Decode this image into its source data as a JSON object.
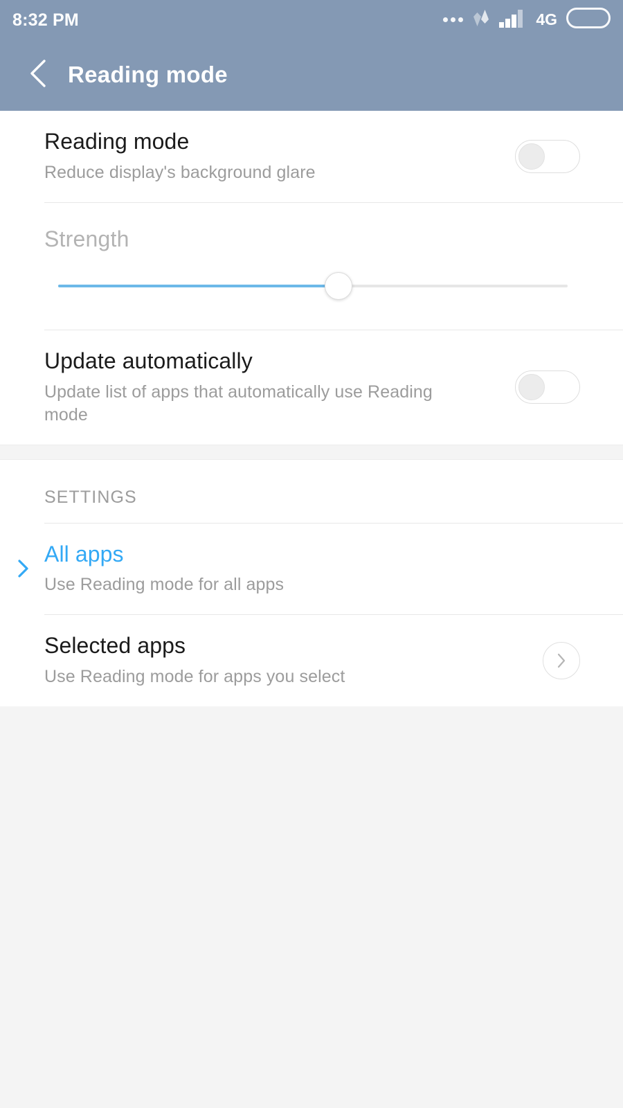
{
  "status_bar": {
    "time": "8:32 PM",
    "network_label": "4G",
    "icons": [
      "more-dots-icon",
      "data-transfer-icon",
      "signal-bars-icon",
      "battery-icon"
    ]
  },
  "app_bar": {
    "back_icon": "chevron-left-icon",
    "title": "Reading mode"
  },
  "colors": {
    "header_bg": "#8499b4",
    "accent_blue": "#33a9f5",
    "slider_fill": "#6cb8e8",
    "card_bg": "#ffffff",
    "page_bg": "#f4f4f4",
    "title_text": "#1b1b1b",
    "subtitle_text": "#9c9c9c",
    "divider": "#e8e8e8"
  },
  "settings": {
    "reading_mode": {
      "title": "Reading mode",
      "subtitle": "Reduce display's background glare",
      "toggle_state": "off"
    },
    "strength": {
      "label": "Strength",
      "value_percent": 55,
      "min": 0,
      "max": 100,
      "enabled": false
    },
    "update_automatically": {
      "title": "Update automatically",
      "subtitle": "Update list of apps that automatically use Reading mode",
      "toggle_state": "off"
    }
  },
  "section": {
    "header": "SETTINGS",
    "items": [
      {
        "title": "All apps",
        "subtitle": "Use Reading mode for all apps",
        "selected": true,
        "marker_icon": "chevron-right-icon"
      },
      {
        "title": "Selected apps",
        "subtitle": "Use Reading mode for apps you select",
        "selected": false,
        "marker_icon": "chevron-right-circle-icon"
      }
    ]
  }
}
